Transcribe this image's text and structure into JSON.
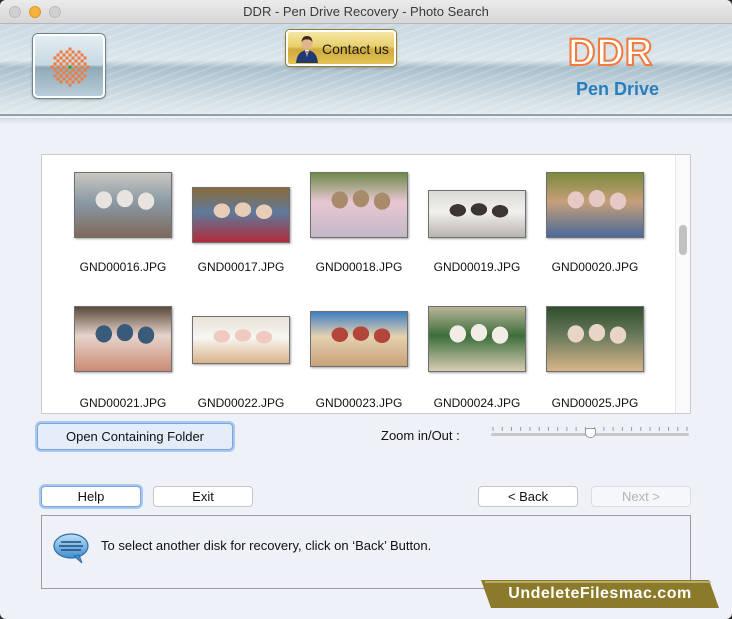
{
  "window": {
    "title": "DDR - Pen Drive Recovery - Photo Search",
    "controls": [
      "close",
      "minimize",
      "maximize"
    ]
  },
  "header": {
    "contact_label": "Contact us",
    "brand": "DDR",
    "product": "Pen Drive",
    "colors": {
      "brand_orange": "#f07b3d",
      "product_blue": "#2a7dbb",
      "contact_gold": "#e9cf6b"
    }
  },
  "gallery": {
    "items": [
      {
        "name": "GND00016.JPG",
        "palette": [
          "#c9c6c1",
          "#7e6a5e",
          "#e8e3de",
          "#8a9aa5"
        ]
      },
      {
        "name": "GND00017.JPG",
        "palette": [
          "#8a6a3a",
          "#b02b3b",
          "#e7cdb8",
          "#5e7a9c"
        ]
      },
      {
        "name": "GND00018.JPG",
        "palette": [
          "#6f8a4a",
          "#c4b8c8",
          "#a88b6b",
          "#e8c7d2"
        ]
      },
      {
        "name": "GND00019.JPG",
        "palette": [
          "#d9d9d6",
          "#b8b4af",
          "#3b3533",
          "#f2f0ec"
        ]
      },
      {
        "name": "GND00020.JPG",
        "palette": [
          "#7b8a3c",
          "#4a6a9a",
          "#e6c8c4",
          "#c79f7a"
        ]
      },
      {
        "name": "GND00021.JPG",
        "palette": [
          "#5b4a3c",
          "#c98c74",
          "#3a5a7a",
          "#e7d3cb"
        ]
      },
      {
        "name": "GND00022.JPG",
        "palette": [
          "#e6e2d8",
          "#d9b38a",
          "#f0c9c0",
          "#f7f6f2"
        ]
      },
      {
        "name": "GND00023.JPG",
        "palette": [
          "#3f7fc1",
          "#c9a27a",
          "#b2463b",
          "#e5d1b0"
        ]
      },
      {
        "name": "GND00024.JPG",
        "palette": [
          "#b8b49a",
          "#d8cbb5",
          "#f1ece6",
          "#3c6e3a"
        ]
      },
      {
        "name": "GND00025.JPG",
        "palette": [
          "#2f4f2c",
          "#d6b58a",
          "#e8d5c8",
          "#6a7a5a"
        ]
      }
    ]
  },
  "controls": {
    "open_folder_label": "Open Containing Folder",
    "zoom_label": "Zoom in/Out :",
    "zoom_level_fraction": 0.5,
    "zoom_tick_count": 22
  },
  "nav": {
    "help_label": "Help",
    "exit_label": "Exit",
    "back_label": "< Back",
    "next_label": "Next >",
    "next_enabled": false
  },
  "info": {
    "message": "To select another disk for recovery, click on ‘Back’ Button."
  },
  "watermark": {
    "text": "UndeleteFilesmac.com",
    "color": "#8a7a2a"
  }
}
